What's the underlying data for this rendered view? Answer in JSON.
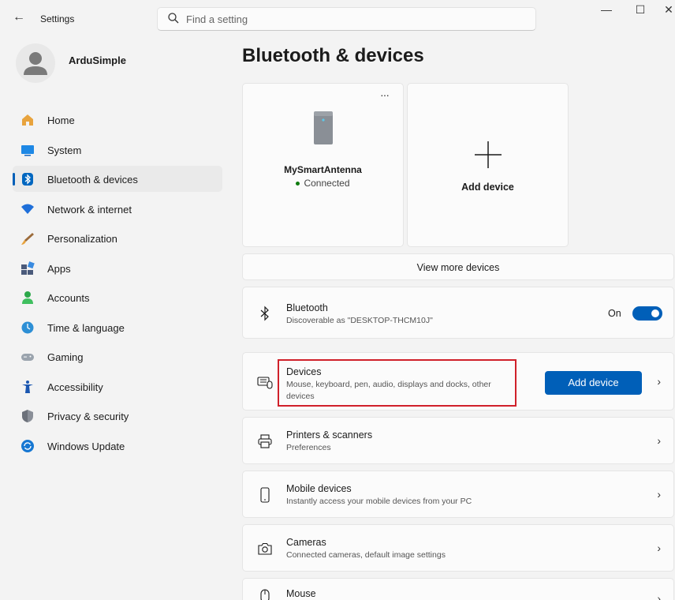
{
  "window": {
    "title": "Settings",
    "back_glyph": "←",
    "minimize_glyph": "—",
    "maximize_glyph": "☐",
    "close_glyph": "✕"
  },
  "search": {
    "placeholder": "Find a setting"
  },
  "profile": {
    "name": "ArduSimple"
  },
  "sidebar": {
    "items": [
      {
        "label": "Home",
        "icon": "home-icon",
        "active": false
      },
      {
        "label": "System",
        "icon": "system-icon",
        "active": false
      },
      {
        "label": "Bluetooth & devices",
        "icon": "bluetooth-icon",
        "active": true
      },
      {
        "label": "Network & internet",
        "icon": "wifi-icon",
        "active": false
      },
      {
        "label": "Personalization",
        "icon": "brush-icon",
        "active": false
      },
      {
        "label": "Apps",
        "icon": "apps-icon",
        "active": false
      },
      {
        "label": "Accounts",
        "icon": "person-icon",
        "active": false
      },
      {
        "label": "Time & language",
        "icon": "clock-globe-icon",
        "active": false
      },
      {
        "label": "Gaming",
        "icon": "gamepad-icon",
        "active": false
      },
      {
        "label": "Accessibility",
        "icon": "accessibility-icon",
        "active": false
      },
      {
        "label": "Privacy & security",
        "icon": "shield-icon",
        "active": false
      },
      {
        "label": "Windows Update",
        "icon": "update-icon",
        "active": false
      }
    ]
  },
  "main": {
    "title": "Bluetooth & devices",
    "device_card": {
      "name": "MySmartAntenna",
      "status": "Connected",
      "more_glyph": "···"
    },
    "add_device_card": {
      "label": "Add device",
      "plus_glyph": "+"
    },
    "view_more": "View more devices",
    "bluetooth": {
      "title": "Bluetooth",
      "subtitle": "Discoverable as \"DESKTOP-THCM10J\"",
      "toggle_label": "On",
      "toggle_on": true
    },
    "devices_row": {
      "title": "Devices",
      "subtitle_line1": "Mouse, keyboard, pen, audio, displays and docks, other",
      "subtitle_line2": "devices",
      "button": "Add device",
      "highlighted": true,
      "highlight_color": "#d0202a"
    },
    "rows": [
      {
        "title": "Printers & scanners",
        "subtitle": "Preferences",
        "icon": "printer-icon"
      },
      {
        "title": "Mobile devices",
        "subtitle": "Instantly access your mobile devices from your PC",
        "icon": "phone-icon"
      },
      {
        "title": "Cameras",
        "subtitle": "Connected cameras, default image settings",
        "icon": "camera-icon"
      },
      {
        "title": "Mouse",
        "subtitle": "",
        "icon": "mouse-icon"
      }
    ],
    "chevron_glyph": "›"
  },
  "colors": {
    "accent": "#005fb8",
    "background": "#f3f3f3",
    "card": "#fbfbfb"
  }
}
